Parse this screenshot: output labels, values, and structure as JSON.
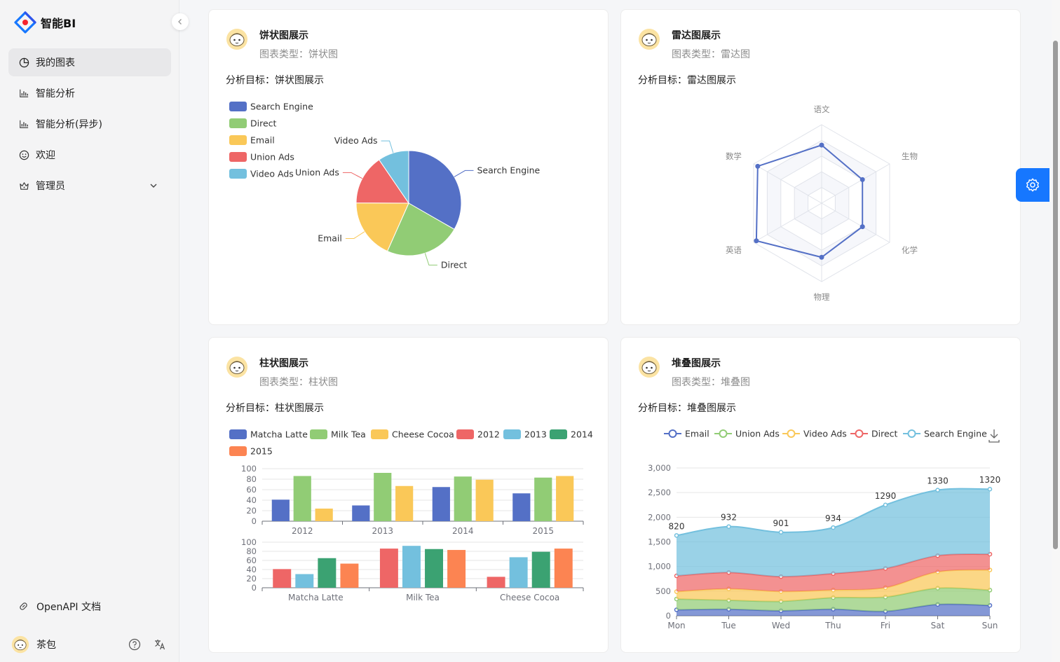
{
  "app": {
    "title": "智能BI"
  },
  "sidebar": {
    "items": [
      {
        "label": "我的图表",
        "icon": "pie-chart-icon",
        "active": true
      },
      {
        "label": "智能分析",
        "icon": "bar-chart-icon"
      },
      {
        "label": "智能分析(异步)",
        "icon": "bar-chart-icon"
      },
      {
        "label": "欢迎",
        "icon": "smile-icon"
      },
      {
        "label": "管理员",
        "icon": "crown-icon"
      }
    ],
    "footer_link": "OpenAPI 文档",
    "user": {
      "name": "茶包"
    }
  },
  "colors": {
    "accent": "#1677ff",
    "blue": "#5470c6",
    "green": "#91cc75",
    "yellow": "#fac858",
    "red": "#ee6666",
    "cyan": "#73c0de",
    "teal": "#3ba272",
    "orange": "#fc8452"
  },
  "cards": [
    {
      "title": "饼状图展示",
      "type_label": "图表类型：饼状图",
      "goal": "分析目标：饼状图展示"
    },
    {
      "title": "雷达图展示",
      "type_label": "图表类型：雷达图",
      "goal": "分析目标：雷达图展示"
    },
    {
      "title": "柱状图展示",
      "type_label": "图表类型：柱状图",
      "goal": "分析目标：柱状图展示"
    },
    {
      "title": "堆叠图展示",
      "type_label": "图表类型：堆叠图",
      "goal": "分析目标：堆叠图展示"
    }
  ],
  "chart_data": [
    {
      "type": "pie",
      "legend": [
        "Search Engine",
        "Direct",
        "Email",
        "Union Ads",
        "Video Ads"
      ],
      "slices": [
        {
          "name": "Search Engine",
          "value": 1048
        },
        {
          "name": "Direct",
          "value": 735
        },
        {
          "name": "Email",
          "value": 580
        },
        {
          "name": "Union Ads",
          "value": 484
        },
        {
          "name": "Video Ads",
          "value": 300
        }
      ]
    },
    {
      "type": "radar",
      "indicators": [
        "语文",
        "生物",
        "化学",
        "物理",
        "英语",
        "数学"
      ],
      "max": 100,
      "values": [
        74,
        60,
        60,
        69,
        96,
        94
      ]
    },
    {
      "type": "bar",
      "legend": [
        "Matcha Latte",
        "Milk Tea",
        "Cheese Cocoa",
        "2012",
        "2013",
        "2014",
        "2015"
      ],
      "top": {
        "categories": [
          "2012",
          "2013",
          "2014",
          "2015"
        ],
        "ylim": [
          0,
          100
        ],
        "yticks": [
          "0",
          "20",
          "40",
          "60",
          "80",
          "100"
        ],
        "series": [
          {
            "name": "Matcha Latte",
            "values": [
              41,
              30,
              65,
              53
            ]
          },
          {
            "name": "Milk Tea",
            "values": [
              86,
              92,
              85,
              83
            ]
          },
          {
            "name": "Cheese Cocoa",
            "values": [
              24,
              67,
              79,
              86
            ]
          }
        ]
      },
      "bottom": {
        "categories": [
          "Matcha Latte",
          "Milk Tea",
          "Cheese Cocoa"
        ],
        "ylim": [
          0,
          100
        ],
        "yticks": [
          "0",
          "20",
          "40",
          "60",
          "80",
          "100"
        ],
        "series": [
          {
            "name": "2012",
            "values": [
              41,
              86,
              24
            ]
          },
          {
            "name": "2013",
            "values": [
              30,
              92,
              67
            ]
          },
          {
            "name": "2014",
            "values": [
              65,
              85,
              79
            ]
          },
          {
            "name": "2015",
            "values": [
              53,
              83,
              86
            ]
          }
        ]
      }
    },
    {
      "type": "area",
      "stacked": true,
      "categories": [
        "Mon",
        "Tue",
        "Wed",
        "Thu",
        "Fri",
        "Sat",
        "Sun"
      ],
      "ylim": [
        0,
        3000
      ],
      "yticks": [
        "0",
        "500",
        "1,000",
        "1,500",
        "2,000",
        "2,500",
        "3,000"
      ],
      "series": [
        {
          "name": "Email",
          "values": [
            120,
            132,
            101,
            134,
            90,
            230,
            210
          ]
        },
        {
          "name": "Union Ads",
          "values": [
            220,
            182,
            191,
            234,
            290,
            330,
            310
          ]
        },
        {
          "name": "Video Ads",
          "values": [
            150,
            232,
            201,
            154,
            190,
            330,
            410
          ]
        },
        {
          "name": "Direct",
          "values": [
            320,
            332,
            301,
            334,
            390,
            330,
            320
          ]
        },
        {
          "name": "Search Engine",
          "values": [
            820,
            932,
            901,
            934,
            1290,
            1330,
            1320
          ]
        }
      ]
    }
  ]
}
